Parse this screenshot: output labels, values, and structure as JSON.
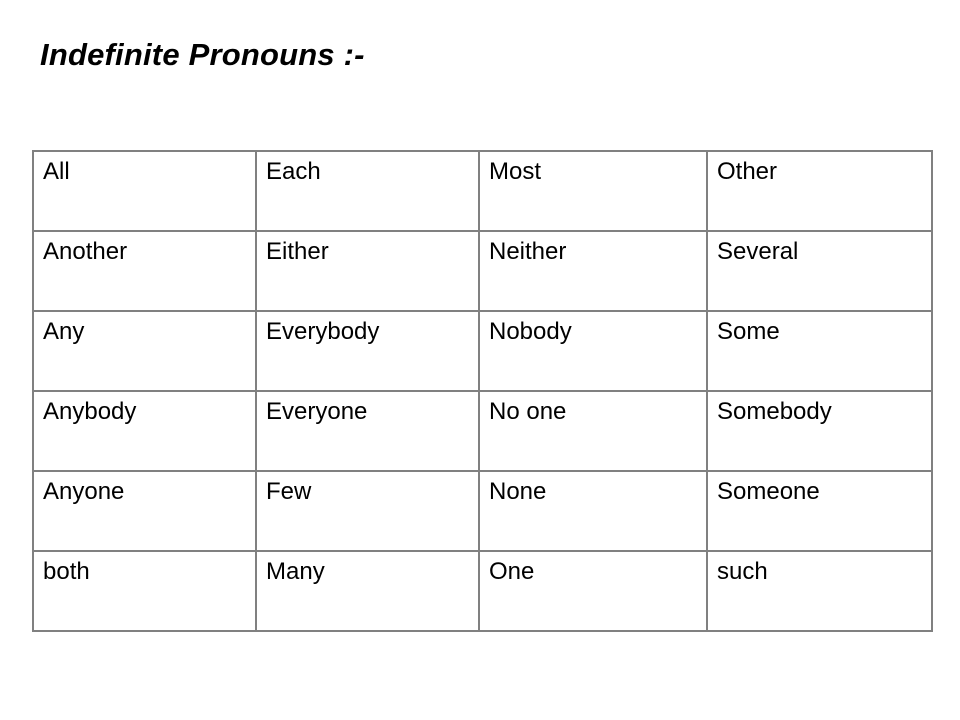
{
  "slide": {
    "title": "Indefinite Pronouns :-",
    "background_color": "#ffffff",
    "text_color": "#000000",
    "table_border_color": "#808080"
  },
  "table": {
    "rows": [
      [
        "All",
        "Each",
        "Most",
        "Other"
      ],
      [
        "Another",
        "Either",
        "Neither",
        "Several"
      ],
      [
        "Any",
        "Everybody",
        "Nobody",
        "Some"
      ],
      [
        "Anybody",
        "Everyone",
        "No one",
        "Somebody"
      ],
      [
        "Anyone",
        "Few",
        "None",
        "Someone"
      ],
      [
        "both",
        "Many",
        "One",
        "such"
      ]
    ]
  }
}
